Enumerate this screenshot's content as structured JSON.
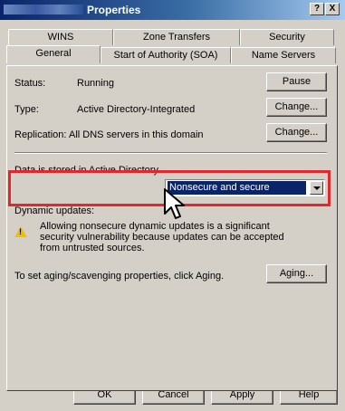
{
  "window": {
    "title": "Properties",
    "help_button": "?",
    "close_button": "X"
  },
  "tabs": {
    "row1": [
      "WINS",
      "Zone Transfers",
      "Security"
    ],
    "row2": [
      "General",
      "Start of Authority (SOA)",
      "Name Servers"
    ],
    "active": "General"
  },
  "general": {
    "status_label": "Status:",
    "status_value": "Running",
    "pause_button": "Pause",
    "type_label": "Type:",
    "type_value": "Active Directory-Integrated",
    "type_change_button": "Change...",
    "replication_label": "Replication:",
    "replication_value": "All DNS servers in this domain",
    "replication_change_button": "Change...",
    "storage_text": "Data is stored in Active Directory.",
    "dynamic_updates_label": "Dynamic updates:",
    "dynamic_updates_value": "Nonsecure and secure",
    "warning_text": "Allowing nonsecure dynamic updates is a significant security vulnerability because updates can be accepted from untrusted sources.",
    "aging_text": "To set aging/scavenging properties, click Aging.",
    "aging_button": "Aging..."
  },
  "footer": {
    "ok": "OK",
    "cancel": "Cancel",
    "apply": "Apply",
    "help": "Help"
  },
  "colors": {
    "highlight_border": "#e4262d",
    "selection": "#0a246a",
    "dialog_face": "#d4d0c8"
  }
}
